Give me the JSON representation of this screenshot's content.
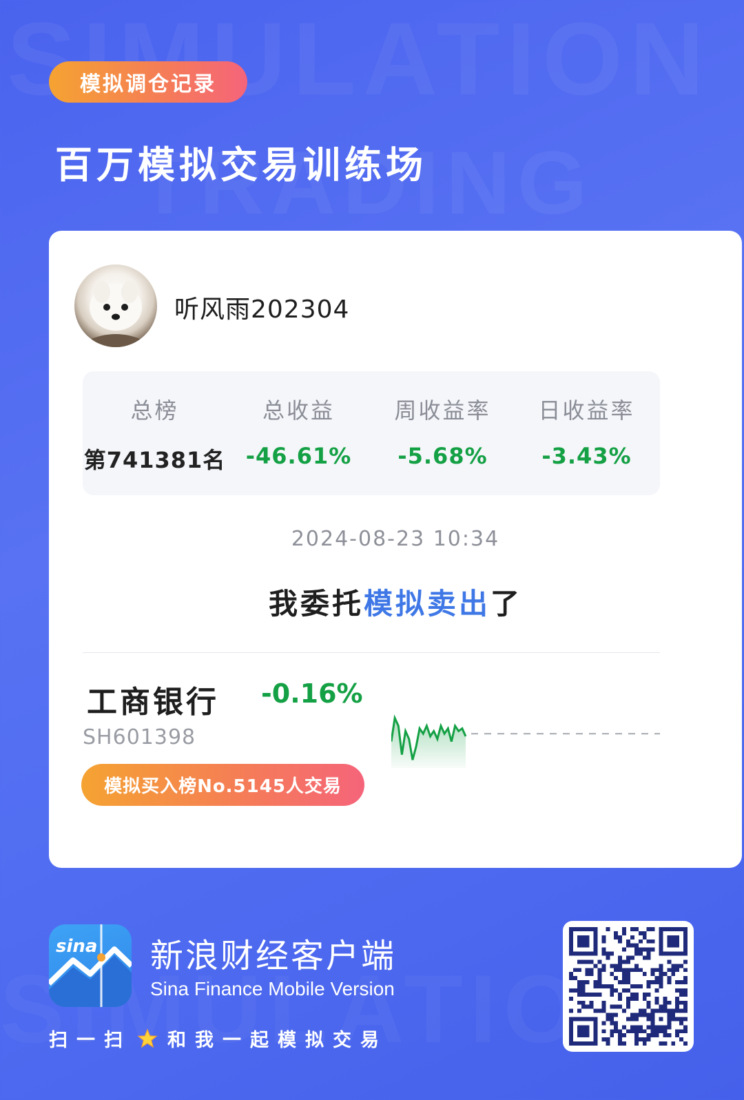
{
  "header": {
    "tag": "模拟调仓记录",
    "title": "百万模拟交易训练场"
  },
  "user": {
    "name": "听风雨202304"
  },
  "stats": [
    {
      "label": "总榜",
      "value": "第741381名"
    },
    {
      "label": "总收益",
      "value": "-46.61%"
    },
    {
      "label": "周收益率",
      "value": "-5.68%"
    },
    {
      "label": "日收益率",
      "value": "-3.43%"
    }
  ],
  "record": {
    "timestamp": "2024-08-23 10:34",
    "action_prefix": "我委托",
    "action_highlight": "模拟卖出",
    "action_suffix": "了"
  },
  "stock": {
    "name": "工商银行",
    "change": "-0.16%",
    "code": "SH601398",
    "rank_pill": "模拟买入榜No.5145人交易"
  },
  "footer": {
    "app_name": "新浪财经客户端",
    "app_subtitle": "Sina Finance Mobile Version",
    "scan_prefix": "扫一扫",
    "scan_suffix": "和我一起模拟交易",
    "logo_text": "sina"
  },
  "watermark": {
    "line1": "SIMULATION",
    "line2": "TRADING",
    "line3": "SIMULATION"
  },
  "icons": {
    "star": "star-icon",
    "qr": "qr-code-icon",
    "logo": "sina-logo-icon"
  },
  "colors": {
    "background": "#4e6bf0",
    "positive_green": "#14a044",
    "highlight_blue": "#3f78e6",
    "pill_gradient_start": "#f5a332",
    "pill_gradient_end": "#f5647a"
  },
  "sparkline": [
    0.6,
    0.15,
    0.3,
    0.85,
    0.4,
    0.55,
    0.95,
    0.7,
    0.35,
    0.45,
    0.3,
    0.5,
    0.4,
    0.55,
    0.3,
    0.45,
    0.35,
    0.6,
    0.3,
    0.4,
    0.35,
    0.5
  ],
  "sparkline_ref": 0.45
}
